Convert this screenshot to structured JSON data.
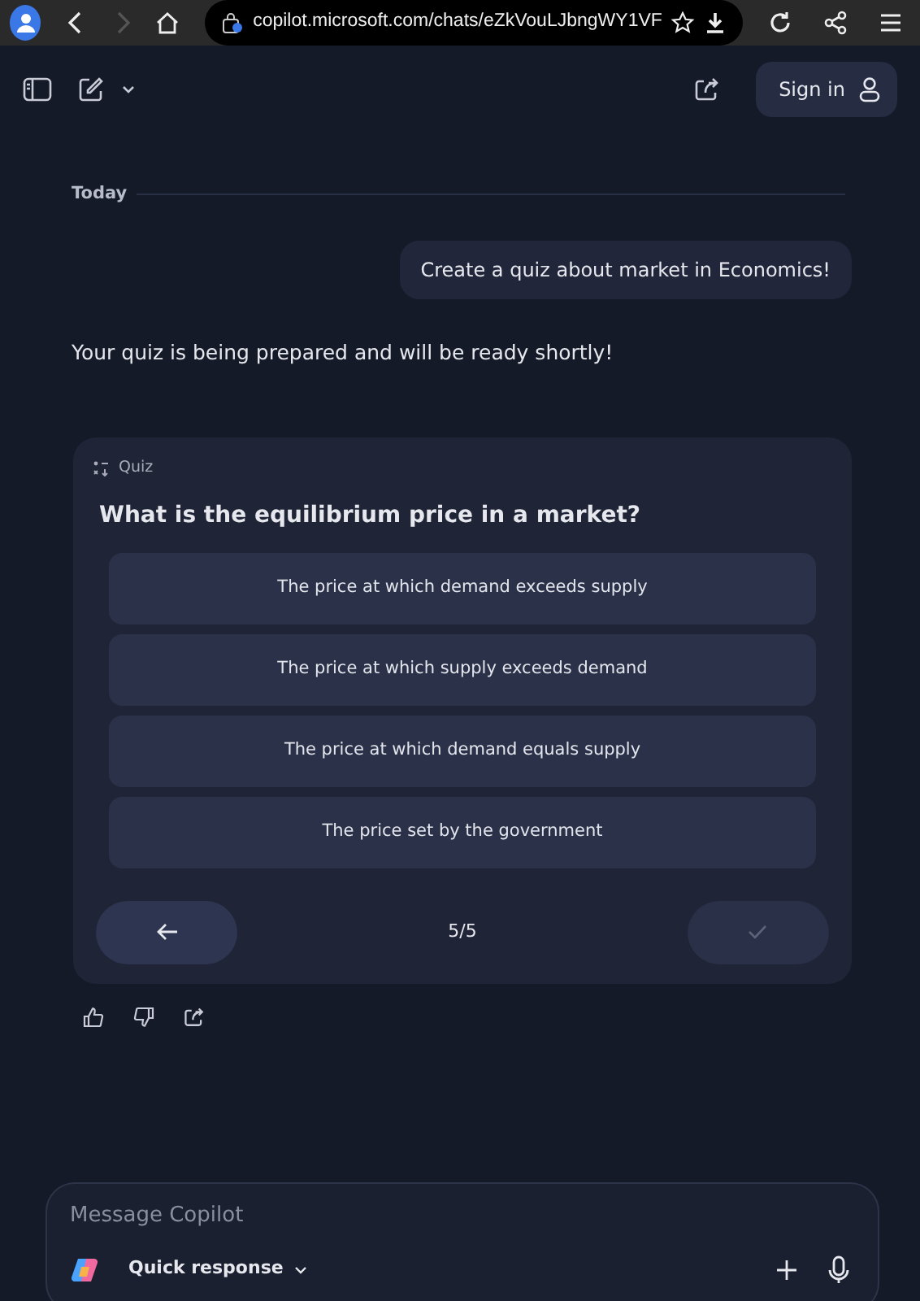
{
  "browser": {
    "url": "copilot.microsoft.com/chats/eZkVouLJbngWY1VF",
    "forward_disabled": true
  },
  "header": {
    "sign_in": "Sign in"
  },
  "chat": {
    "date": "Today",
    "user_message": "Create a quiz about market in Economics!",
    "assistant_message": "Your quiz is being prepared and will be ready shortly!",
    "quiz": {
      "label": "Quiz",
      "question": "What is the equilibrium price in a market?",
      "options": [
        {
          "text": "The price at which demand exceeds supply"
        },
        {
          "text": "The price at which supply exceeds demand"
        },
        {
          "text": "The price at which demand equals supply"
        },
        {
          "text": "The price set by the government"
        }
      ],
      "counter": "5/5",
      "submit_disabled": true
    }
  },
  "composer": {
    "placeholder": "Message Copilot",
    "mode": "Quick response"
  }
}
